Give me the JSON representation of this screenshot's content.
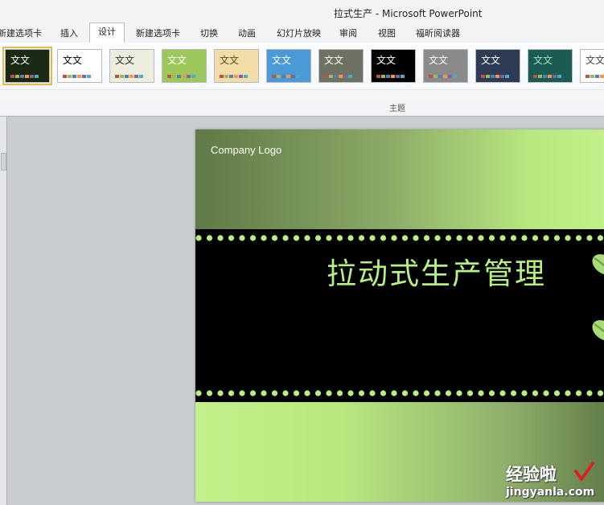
{
  "window": {
    "title": "拉式生产 - Microsoft PowerPoint"
  },
  "tabs": [
    {
      "label": "新建选项卡",
      "active": false
    },
    {
      "label": "插入",
      "active": false
    },
    {
      "label": "设计",
      "active": true
    },
    {
      "label": "新建选项卡",
      "active": false
    },
    {
      "label": "切换",
      "active": false
    },
    {
      "label": "动画",
      "active": false
    },
    {
      "label": "幻灯片放映",
      "active": false
    },
    {
      "label": "审阅",
      "active": false
    },
    {
      "label": "视图",
      "active": false
    },
    {
      "label": "福昕阅读器",
      "active": false
    }
  ],
  "ribbon": {
    "group_label": "主题",
    "themes": [
      {
        "text": "文文",
        "bg": "#1a2a12",
        "fg": "#ffffff",
        "selected": true
      },
      {
        "text": "文文",
        "bg": "#ffffff",
        "fg": "#000000",
        "selected": false
      },
      {
        "text": "文文",
        "bg": "#eceddd",
        "fg": "#333333",
        "selected": false
      },
      {
        "text": "文文",
        "bg": "#9cc75a",
        "fg": "#ffffff",
        "selected": false
      },
      {
        "text": "文文",
        "bg": "#f2dca8",
        "fg": "#6a4a1a",
        "selected": false
      },
      {
        "text": "文文",
        "bg": "#4a9ad8",
        "fg": "#ffffff",
        "selected": false
      },
      {
        "text": "文文",
        "bg": "#6d7263",
        "fg": "#ffffff",
        "selected": false
      },
      {
        "text": "文文",
        "bg": "#000000",
        "fg": "#ffffff",
        "selected": false
      },
      {
        "text": "文文",
        "bg": "#8a8a8a",
        "fg": "#ffffff",
        "selected": false
      },
      {
        "text": "文文",
        "bg": "#2d3c54",
        "fg": "#ffffff",
        "selected": false
      },
      {
        "text": "文文",
        "bg": "#1c5a54",
        "fg": "#9ae0c0",
        "selected": false
      },
      {
        "text": "文文",
        "bg": "#ffffff",
        "fg": "#444444",
        "selected": false
      }
    ]
  },
  "slide": {
    "logo_text": "Company Logo",
    "title": "拉动式生产管理",
    "colors": {
      "accent": "#b6f080",
      "band": "#000000"
    }
  },
  "watermark": {
    "main": "经验啦",
    "sub": "jingyanla.com"
  }
}
